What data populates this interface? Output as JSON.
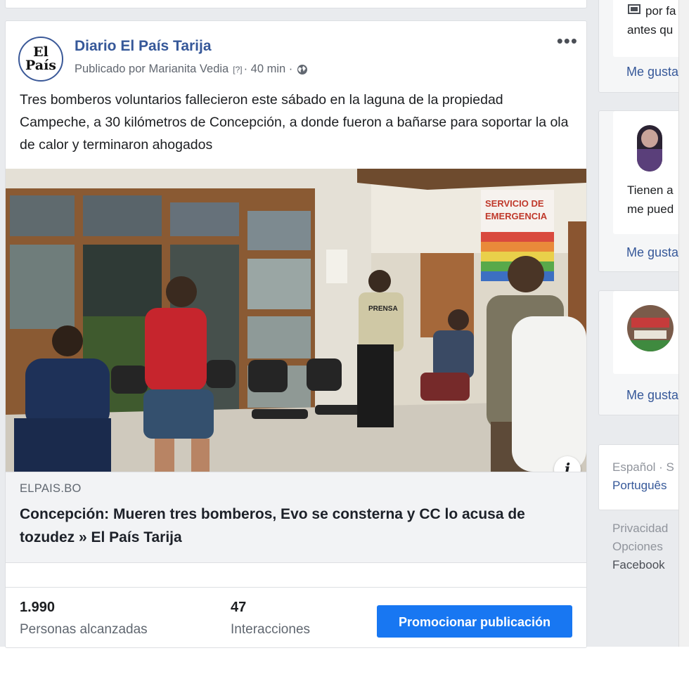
{
  "post": {
    "page_name": "Diario El País Tarija",
    "avatar_line1": "El",
    "avatar_line2": "País",
    "published_by": "Publicado por Marianita Vedia",
    "help_mark": "[?]",
    "time": "· 40 min ·",
    "more_label": "•••",
    "text": "Tres bomberos voluntarios fallecieron este sábado en la laguna de la propiedad Campeche, a 30 kilómetros de Concepción, a donde fueron a bañarse para soportar la ola de calor y terminaron ahogados",
    "photo_sign_line1": "SERVICIO DE",
    "photo_sign_line2": "EMERGENCIA",
    "photo_vest_text": "PRENSA",
    "info_label": "i",
    "link_domain": "ELPAIS.BO",
    "link_headline": "Concepción: Mueren tres bomberos, Evo se consterna y CC lo acusa de tozudez » El País Tarija",
    "stats": {
      "reached_value": "1.990",
      "reached_label": "Personas alcanzadas",
      "interactions_value": "47",
      "interactions_label": "Interacciones"
    },
    "promote_label": "Promocionar publicación"
  },
  "right_column": {
    "card1_line1": "por fa",
    "card1_line2": "antes qu",
    "card1_like": "Me gusta",
    "card2_line1": "Tienen a",
    "card2_line2": "me pued",
    "card2_like": "Me gusta",
    "card3_like": "Me gusta",
    "lang_current": "Español · S",
    "lang_other": "Português",
    "footer_privacy": "Privacidad",
    "footer_options": "Opciones",
    "footer_facebook": "Facebook"
  },
  "colors": {
    "link_blue": "#365899",
    "button_blue": "#1877f2",
    "page_bg": "#e9ebee"
  }
}
